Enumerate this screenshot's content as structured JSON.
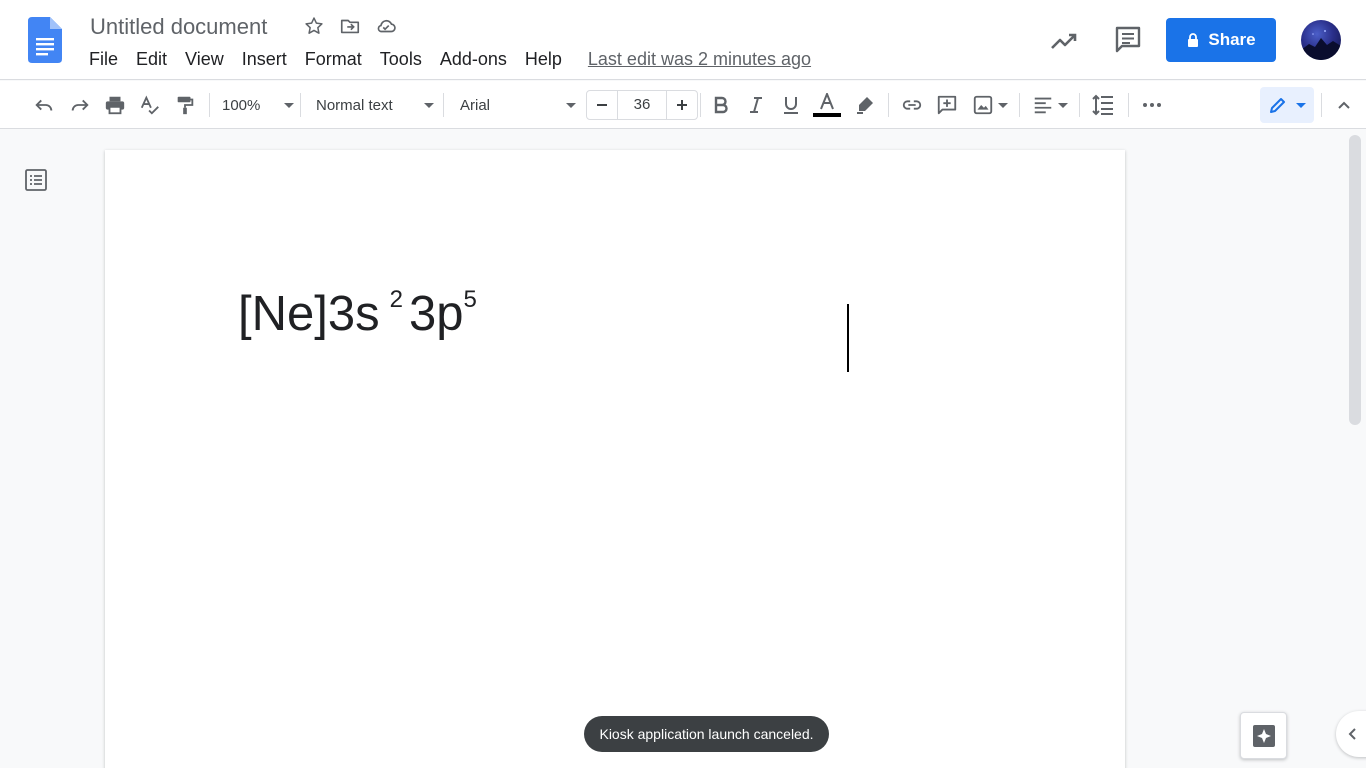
{
  "header": {
    "doc_title": "Untitled document",
    "title_icons": [
      "star-icon",
      "move-to-folder-icon",
      "cloud-status-icon"
    ],
    "menu": [
      "File",
      "Edit",
      "View",
      "Insert",
      "Format",
      "Tools",
      "Add-ons",
      "Help"
    ],
    "last_edit": "Last edit was 2 minutes ago",
    "share_label": "Share",
    "right_icons": [
      "activity-trend-icon",
      "comments-icon"
    ]
  },
  "toolbar": {
    "zoom": "100%",
    "style": "Normal text",
    "font": "Arial",
    "font_size": "36",
    "text_color": "#000000",
    "icons": [
      "undo-icon",
      "redo-icon",
      "print-icon",
      "spellcheck-icon",
      "paint-format-icon",
      "bold-icon",
      "italic-icon",
      "underline-icon",
      "text-color-icon",
      "highlight-icon",
      "link-icon",
      "add-comment-icon",
      "insert-image-icon",
      "align-icon",
      "line-spacing-icon",
      "more-icon",
      "editing-mode-icon",
      "collapse-icon"
    ]
  },
  "document": {
    "text_main": "[Ne]3s",
    "sup1": "2",
    "text_mid": "3p",
    "sup2": "5"
  },
  "toast": {
    "message": "Kiosk application launch canceled."
  },
  "colors": {
    "accent": "#1a73e8",
    "toast_bg": "#3c4043"
  }
}
